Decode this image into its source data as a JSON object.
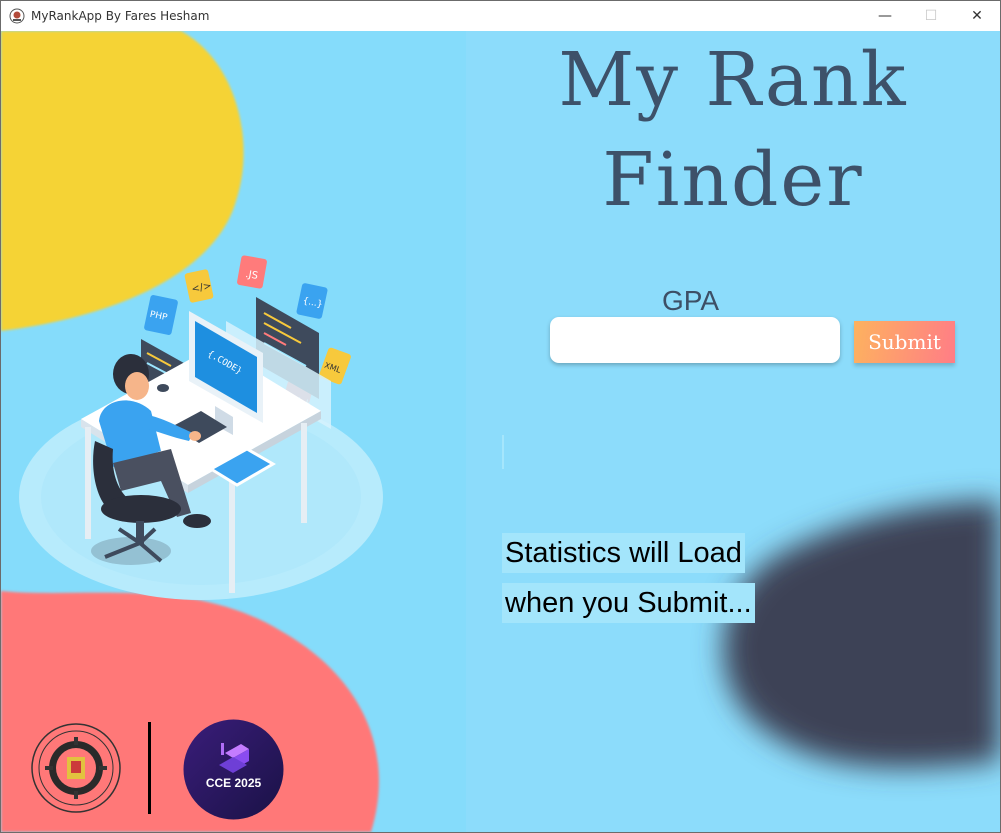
{
  "window": {
    "title": "MyRankApp By Fares Hesham",
    "controls": {
      "minimize": "—",
      "maximize": "☐",
      "close": "✕"
    }
  },
  "main": {
    "title_line1": "My Rank",
    "title_line2": "Finder",
    "gpa_label": "GPA",
    "gpa_value": "",
    "gpa_placeholder": "",
    "submit_label": "Submit",
    "stats_line1": "Statistics will Load",
    "stats_line2": "when you Submit..."
  },
  "logos": {
    "event_text": "CCE 2025"
  },
  "colors": {
    "background": "#8ddcf8",
    "title": "#3d5169",
    "yellow_blob": "#f5d334",
    "red_blob": "#ff7878",
    "dark_blob": "#3e4257",
    "submit_gradient_start": "#fdb25f",
    "submit_gradient_end": "#ff7d86"
  },
  "icons": {
    "app": "university-seal-icon",
    "illustration": "developer-at-desk-illustration"
  }
}
